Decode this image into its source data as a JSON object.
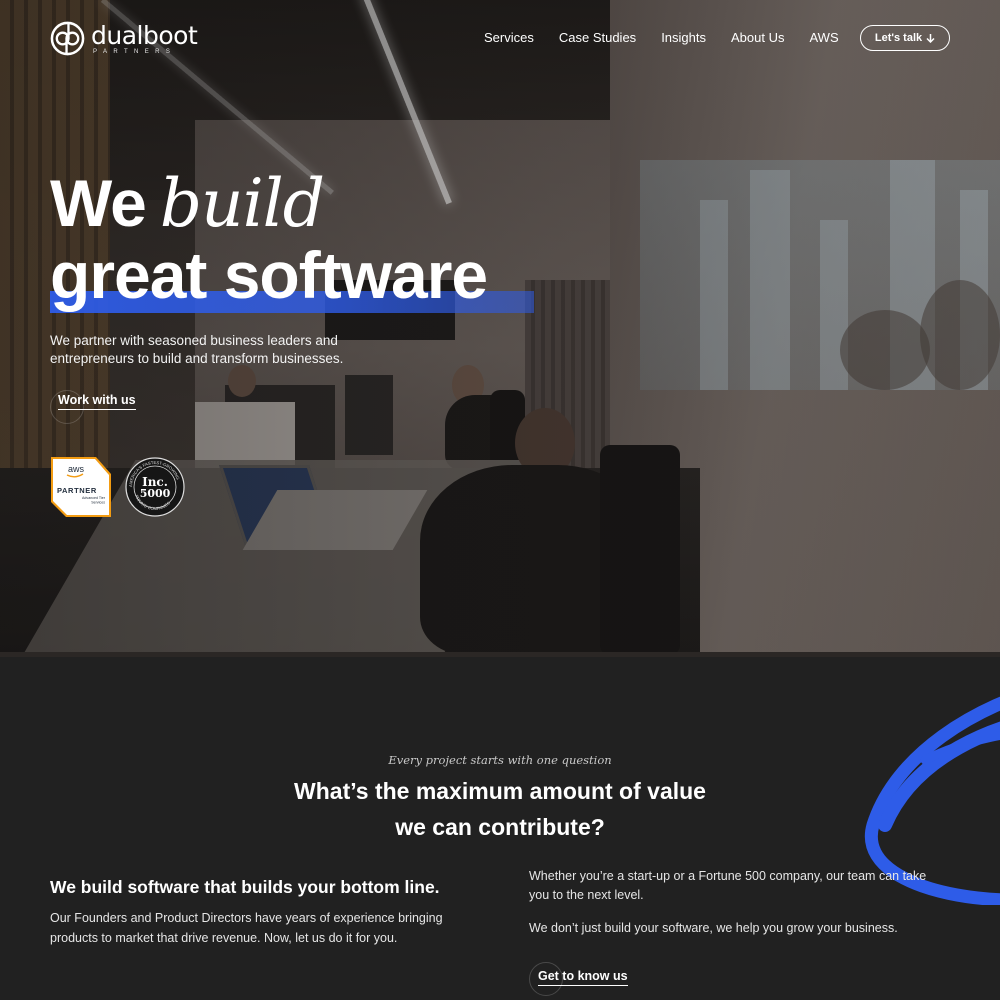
{
  "brand": {
    "name": "dualboot",
    "sub": "PARTNERS"
  },
  "nav": {
    "links": [
      "Services",
      "Case Studies",
      "Insights",
      "About Us",
      "AWS"
    ],
    "cta_label": "Let's talk",
    "cta_icon": "arrow-down-icon"
  },
  "hero": {
    "headline_we": "We",
    "headline_build": "build",
    "headline_line2": "great software",
    "subtext": "We partner with seasoned business leaders and entrepreneurs to build and transform businesses.",
    "work_label": "Work with us",
    "badges": {
      "aws_top": "aws",
      "aws_main": "PARTNER",
      "aws_tier1": "Advanced Tier",
      "aws_tier2": "Services",
      "inc_top": "Inc.",
      "inc_num": "5000",
      "inc_ring_top": "AMERICA'S FASTEST-GROWING",
      "inc_ring_bottom": "PRIVATE COMPANIES"
    }
  },
  "section2": {
    "eyebrow": "Every project starts with one question",
    "title_line1": "What’s the maximum amount of value",
    "title_line2": "we can contribute?",
    "left_heading": "We build software that builds your bottom line.",
    "left_body": "Our Founders and Product Directors have years of experience bringing products to market that drive revenue. Now, let us do it for you.",
    "right_p1": "Whether you’re a start-up or a Fortune 500 company, our team can take you to the next level.",
    "right_p2": "We don’t just build your software, we help you grow your business.",
    "know_label": "Get to know us"
  },
  "colors": {
    "accent_blue": "#2e5ce8",
    "section_bg": "#212121",
    "aws_orange": "#f39c12"
  }
}
